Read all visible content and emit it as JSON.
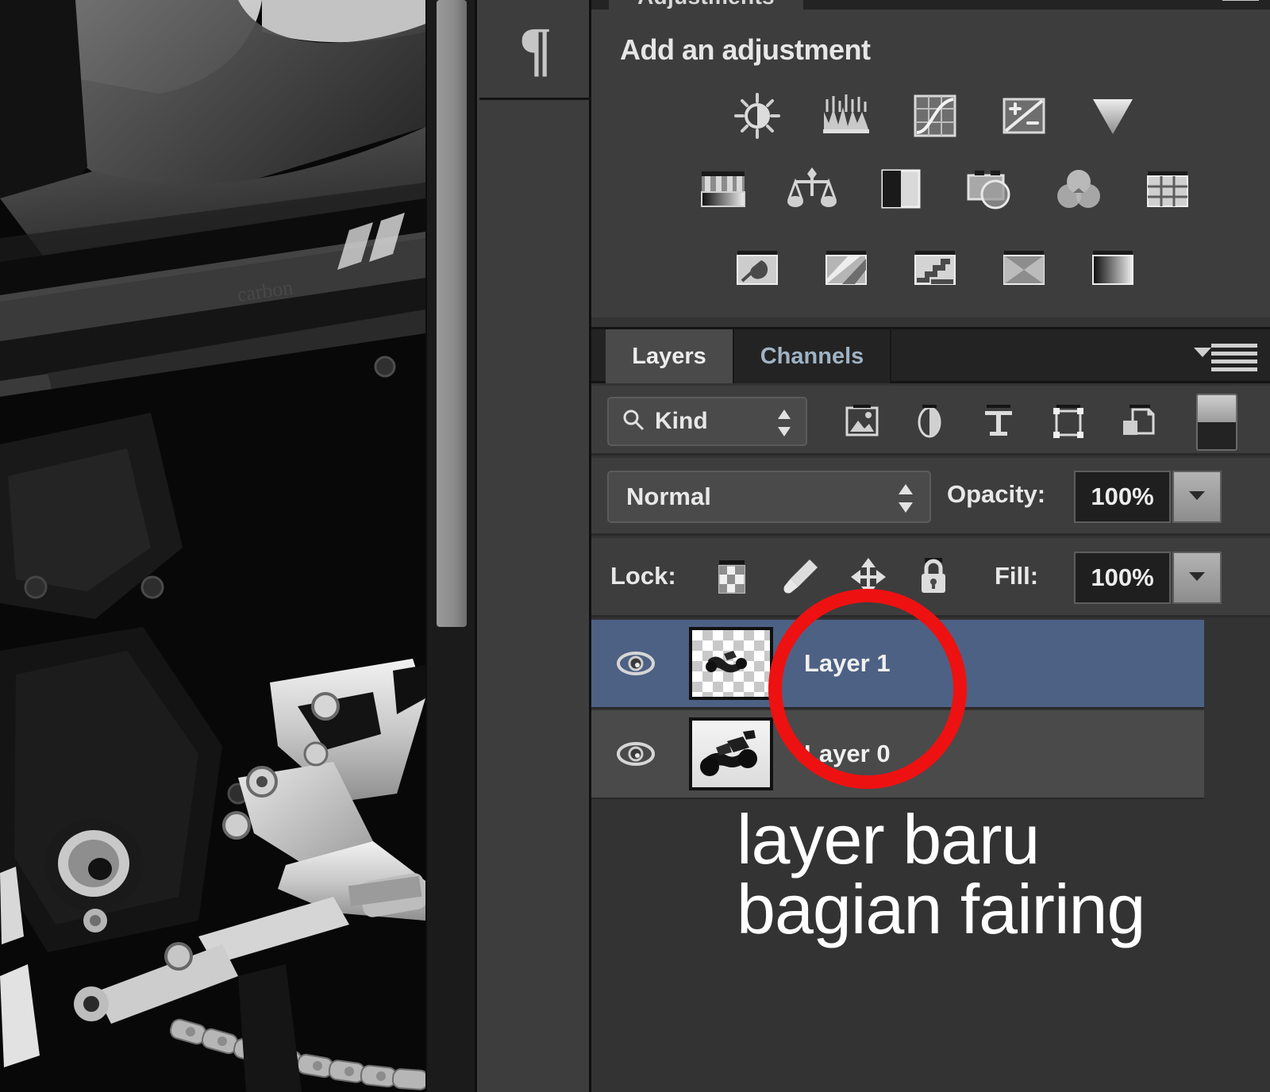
{
  "app": {
    "name": "Adobe Photoshop",
    "theme_bg": "#3d3d3d",
    "accent_selected": "#4d6184"
  },
  "canvas": {
    "name": "motorcycle-photo",
    "description": "Close-up photograph of a dark sport motorcycle fairing, frame, rearset footpeg and drive chain"
  },
  "scrollbar": {
    "name": "canvas-vertical-scrollbar",
    "thumb_position": "top"
  },
  "icon_dock": {
    "buttons": [
      {
        "name": "paragraph-panel-button",
        "icon": "paragraph-icon",
        "glyph": "¶"
      }
    ]
  },
  "adjustments": {
    "tab_label": "Adjustments",
    "heading": "Add an adjustment",
    "panel_menu_label": "Panel menu",
    "rows": [
      [
        {
          "label": "Brightness/Contrast",
          "icon": "brightness-contrast-icon"
        },
        {
          "label": "Levels",
          "icon": "levels-icon"
        },
        {
          "label": "Curves",
          "icon": "curves-icon"
        },
        {
          "label": "Exposure",
          "icon": "exposure-icon"
        },
        {
          "label": "Vibrance",
          "icon": "vibrance-icon"
        }
      ],
      [
        {
          "label": "Hue/Saturation",
          "icon": "hue-saturation-icon"
        },
        {
          "label": "Color Balance",
          "icon": "color-balance-icon"
        },
        {
          "label": "Black & White",
          "icon": "black-white-icon"
        },
        {
          "label": "Photo Filter",
          "icon": "photo-filter-icon"
        },
        {
          "label": "Channel Mixer",
          "icon": "channel-mixer-icon"
        },
        {
          "label": "Color Lookup",
          "icon": "color-lookup-icon"
        }
      ],
      [
        {
          "label": "Invert",
          "icon": "invert-icon"
        },
        {
          "label": "Posterize",
          "icon": "posterize-icon"
        },
        {
          "label": "Threshold",
          "icon": "threshold-icon"
        },
        {
          "label": "Gradient Map",
          "icon": "gradient-map-icon"
        },
        {
          "label": "Selective Color",
          "icon": "selective-color-icon"
        }
      ]
    ]
  },
  "layers_panel": {
    "tabs": [
      {
        "label": "Layers",
        "active": true
      },
      {
        "label": "Channels",
        "active": false
      }
    ],
    "panel_menu_label": "Panel menu",
    "filter": {
      "kind_label": "Kind",
      "search_icon": "magnifier-icon",
      "stepper_icon": "stepper-updown-icon",
      "type_filters": [
        {
          "name": "filter-pixel-layers",
          "icon": "image-icon"
        },
        {
          "name": "filter-adjustment-layers",
          "icon": "adjustment-circle-icon"
        },
        {
          "name": "filter-type-layers",
          "icon": "type-t-icon"
        },
        {
          "name": "filter-shape-layers",
          "icon": "shape-bounds-icon"
        },
        {
          "name": "filter-smart-objects",
          "icon": "smart-object-icon"
        }
      ],
      "toggle_name": "filter-enable-toggle"
    },
    "blend": {
      "mode": "Normal",
      "opacity_label": "Opacity:",
      "opacity_value": "100%"
    },
    "lock": {
      "label": "Lock:",
      "buttons": [
        {
          "name": "lock-transparent-pixels",
          "icon": "checkerboard-icon"
        },
        {
          "name": "lock-image-pixels",
          "icon": "brush-icon"
        },
        {
          "name": "lock-position",
          "icon": "move-arrows-icon"
        },
        {
          "name": "lock-all",
          "icon": "padlock-icon"
        }
      ],
      "fill_label": "Fill:",
      "fill_value": "100%"
    },
    "layers": [
      {
        "name": "Layer 1",
        "visible": true,
        "selected": true,
        "thumbnail": "transparent-with-small-motorcycle-cutout",
        "eye_icon": "eye-icon"
      },
      {
        "name": "Layer 0",
        "visible": true,
        "selected": false,
        "thumbnail": "motorcycle-photo-thumbnail",
        "eye_icon": "eye-icon"
      }
    ]
  },
  "annotations": {
    "circle": {
      "name": "red-highlight-circle",
      "color": "#ee1111",
      "targets": "Layer 1 row"
    },
    "caption_line_1": "layer baru",
    "caption_line_2": "bagian fairing",
    "caption_color": "#ffffff"
  }
}
